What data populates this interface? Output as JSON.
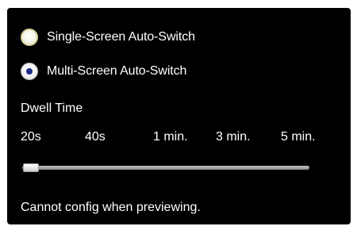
{
  "options": {
    "single_screen": {
      "label": "Single-Screen Auto-Switch",
      "selected": false
    },
    "multi_screen": {
      "label": "Multi-Screen Auto-Switch",
      "selected": true
    }
  },
  "dwell": {
    "title": "Dwell Time",
    "ticks": [
      "20s",
      "40s",
      "1 min.",
      "3 min.",
      "5 min."
    ],
    "selected_index": 0
  },
  "status_text": "Cannot config when previewing.",
  "colors": {
    "panel_bg": "#000000",
    "text": "#ffffff",
    "radio_dot": "#1f2a8a"
  }
}
